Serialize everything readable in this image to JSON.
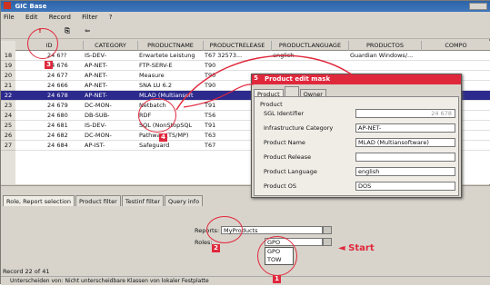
{
  "window": {
    "title": "GIC Base"
  },
  "menu": [
    "File",
    "Edit",
    "Record",
    "Filter",
    "?"
  ],
  "toolbar": {
    "exclaim": "!",
    "copy": "⎘",
    "back": "⇦"
  },
  "table": {
    "columns": [
      "ID",
      "CATEGORY",
      "PRODUCTNAME",
      "PRODUCTRELEASE",
      "PRODUCTLANGUAGE",
      "PRODUCTOS",
      "COMPO"
    ],
    "rows": [
      {
        "n": "18",
        "id": "24 6??",
        "cat": "IS-DEV-",
        "name": "Erwartete Leistung",
        "rel": "T67 32573...",
        "lang": "english",
        "os": "Guardian Windows/..."
      },
      {
        "n": "19",
        "id": "24 676",
        "cat": "AP-NET-",
        "name": "FTP-SERV-E",
        "rel": "T90",
        "lang": "",
        "os": ""
      },
      {
        "n": "20",
        "id": "24 677",
        "cat": "AP-NET-",
        "name": "Measure",
        "rel": "T90",
        "lang": "",
        "os": ""
      },
      {
        "n": "21",
        "id": "24 666",
        "cat": "AP-NET-",
        "name": "SNA LU 6.2",
        "rel": "T90",
        "lang": "",
        "os": ""
      },
      {
        "n": "22",
        "id": "24 678",
        "cat": "AP-NET-",
        "name": "MLAD (Multiansoft",
        "rel": "",
        "lang": "",
        "os": ""
      },
      {
        "n": "23",
        "id": "24 679",
        "cat": "DC-MON-",
        "name": "Netbatch",
        "rel": "T91",
        "lang": "",
        "os": ""
      },
      {
        "n": "24",
        "id": "24 680",
        "cat": "DB-SUB-",
        "name": "RDF",
        "rel": "T56",
        "lang": "",
        "os": ""
      },
      {
        "n": "25",
        "id": "24 681",
        "cat": "IS-DEV-",
        "name": "SQL (NonStopSQL",
        "rel": "T91",
        "lang": "",
        "os": ""
      },
      {
        "n": "26",
        "id": "24 682",
        "cat": "DC-MON-",
        "name": "Pathway (TS/MP)",
        "rel": "T63",
        "lang": "",
        "os": ""
      },
      {
        "n": "27",
        "id": "24 684",
        "cat": "AP-IST-",
        "name": "Safeguard",
        "rel": "T67",
        "lang": "",
        "os": ""
      }
    ],
    "selected_index": 4
  },
  "panel": {
    "tabs": [
      "Role, Report selection",
      "Product filter",
      "Testinf filter",
      "Query info"
    ],
    "reports_label": "Reports:",
    "reports_value": "MyProducts",
    "roles_label": "Roles:",
    "roles_value": "GPO",
    "roles_options": [
      "GPO",
      "TOW"
    ],
    "start_label": "◄ Start"
  },
  "dialog": {
    "title": "Product edit mask",
    "tabs": [
      "Product",
      "",
      "Owner"
    ],
    "section": "Product",
    "fields": [
      {
        "label": "SGL Identifier",
        "value": "24 678"
      },
      {
        "label": "Infrastructure Category",
        "value": "AP-NET-"
      },
      {
        "label": "Product Name",
        "value": "MLAD (Multiansoftware)"
      },
      {
        "label": "Product Release",
        "value": ""
      },
      {
        "label": "Product Language",
        "value": "english"
      },
      {
        "label": "Product OS",
        "value": "DOS"
      }
    ]
  },
  "markers": [
    "1",
    "2",
    "3",
    "4",
    "5"
  ],
  "status": {
    "record": "Record 22 of 41",
    "hint": "Unterscheiden von: Nicht unterscheidbare Klassen von lokaler Festplatte"
  },
  "colors": {
    "accent": "#e0283c",
    "selection": "#2c2a8d"
  }
}
